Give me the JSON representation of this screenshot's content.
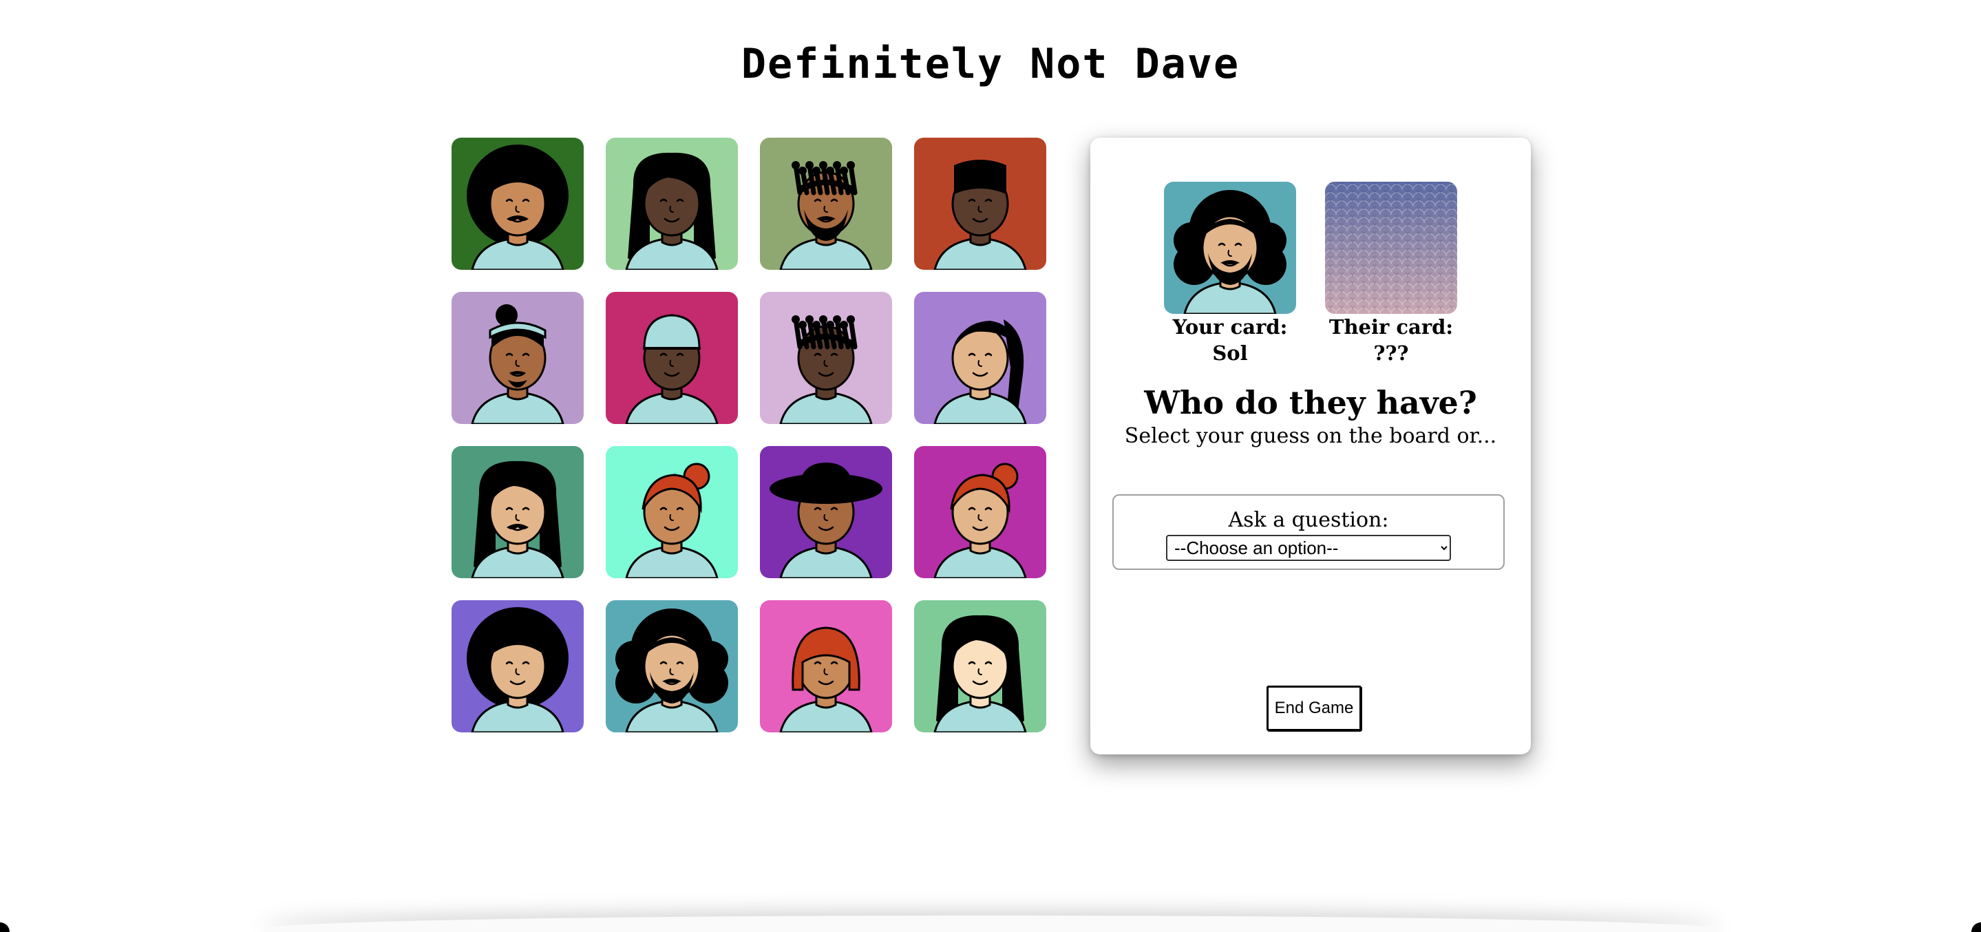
{
  "title": "Definitely Not Dave",
  "board": {
    "cards": [
      {
        "bg": "#2f6f23",
        "skin": "#c98a5a",
        "hair": "afro",
        "facial": "mustache"
      },
      {
        "bg": "#98d49c",
        "skin": "#5b3d2e",
        "hair": "long-wavy",
        "facial": "none"
      },
      {
        "bg": "#8fa872",
        "skin": "#a86a40",
        "hair": "twists",
        "facial": "beard"
      },
      {
        "bg": "#b84428",
        "skin": "#5b3d2e",
        "hair": "flat-top",
        "facial": "none"
      },
      {
        "bg": "#b79acb",
        "skin": "#a86a40",
        "hair": "bandana-bun",
        "facial": "goatee"
      },
      {
        "bg": "#c42a6e",
        "skin": "#5b3d2e",
        "hair": "beanie",
        "facial": "none"
      },
      {
        "bg": "#d6b3d9",
        "skin": "#5b3d2e",
        "hair": "twists",
        "facial": "none"
      },
      {
        "bg": "#a57fd1",
        "skin": "#e3b58a",
        "hair": "braids",
        "facial": "none"
      },
      {
        "bg": "#4e9b7e",
        "skin": "#e3b58a",
        "hair": "long-wavy",
        "facial": "mustache"
      },
      {
        "bg": "#7dfad6",
        "skin": "#c98a5a",
        "hair": "red-bun",
        "facial": "none"
      },
      {
        "bg": "#7d2fb0",
        "skin": "#a86a40",
        "hair": "hat",
        "facial": "none"
      },
      {
        "bg": "#b72fa7",
        "skin": "#e3b58a",
        "hair": "red-bun",
        "facial": "none"
      },
      {
        "bg": "#7b63d1",
        "skin": "#e3b58a",
        "hair": "afro",
        "facial": "none"
      },
      {
        "bg": "#5aaab5",
        "skin": "#e3b58a",
        "hair": "curly-long",
        "facial": "beard"
      },
      {
        "bg": "#e65fbd",
        "skin": "#c98a5a",
        "hair": "red-bob",
        "facial": "none"
      },
      {
        "bg": "#7fcb98",
        "skin": "#fae0bf",
        "hair": "long-wavy",
        "facial": "none"
      }
    ]
  },
  "panel": {
    "your_card_label": "Your card:",
    "your_card_name": "Sol",
    "your_card": {
      "bg": "#5aaab5",
      "skin": "#e3b58a",
      "hair": "curly-long",
      "facial": "beard"
    },
    "their_card_label": "Their card:",
    "their_card_name": "???",
    "heading": "Who do they have?",
    "subheading": "Select your guess on the board or...",
    "ask_label": "Ask a question:",
    "select_value": "--Choose an option--",
    "end_button": "End Game"
  },
  "colors": {
    "shirt": "#a9dcdc",
    "hair": "#000000",
    "hair_red": "#c9401c",
    "card_back_top": "#5b6aa3",
    "card_back_bottom": "#c9a7b1"
  }
}
